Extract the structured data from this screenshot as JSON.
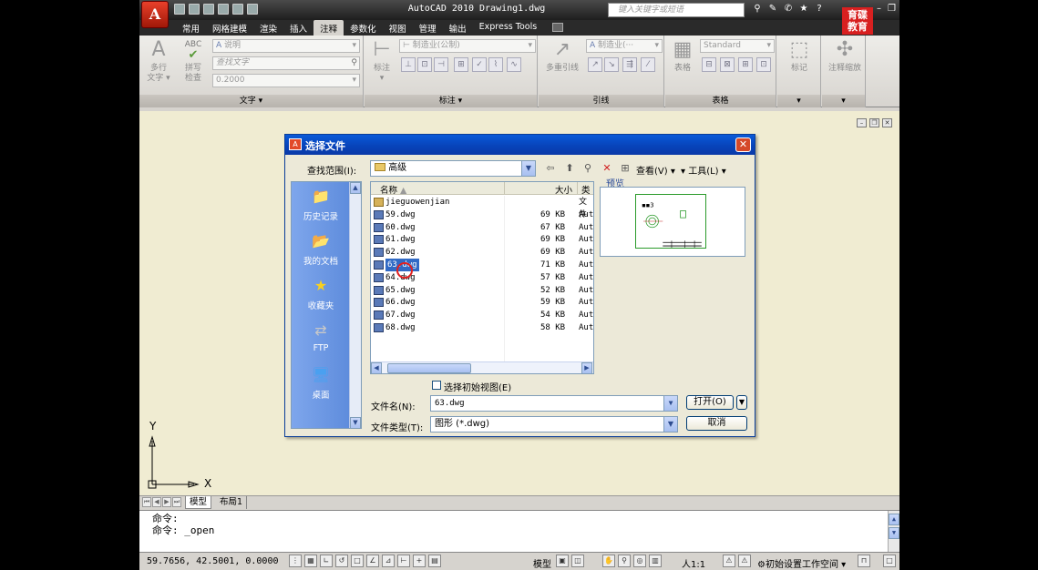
{
  "titlebar": {
    "app_logo": "A",
    "title": "AutoCAD 2010  Drawing1.dwg",
    "search_placeholder": "键入关键字或短语",
    "watermark_line1": "育碟",
    "watermark_line2": "教育"
  },
  "ribbon_tabs": [
    "常用",
    "网格建模",
    "渲染",
    "插入",
    "注释",
    "参数化",
    "视图",
    "管理",
    "输出",
    "Express Tools"
  ],
  "ribbon_active_tab": "注释",
  "ribbon": {
    "text_group": {
      "title": "文字",
      "multiline_text_label_1": "多行",
      "multiline_text_label_2": "文字",
      "spell_label_1": "拼写",
      "spell_label_2": "检查",
      "style_value": "说明",
      "find_placeholder": "查找文字",
      "height_value": "0.2000"
    },
    "dimension_group": {
      "title": "标注",
      "dim_label": "标注",
      "style_value": "制造业(公制)"
    },
    "leader_group": {
      "title": "引线",
      "multileader_label": "多重引线",
      "style_value": "制造业(···"
    },
    "table_group": {
      "title": "表格",
      "table_label": "表格",
      "style_value": "Standard"
    },
    "markup_group": {
      "markup_label": "标记"
    },
    "annoscale_group": {
      "annoscale_label": "注释缩放"
    }
  },
  "drawing": {
    "ucs_x": "X",
    "ucs_y": "Y"
  },
  "layout_tabs": {
    "model": "模型",
    "layout1": "布局1"
  },
  "command_line": {
    "line1": "命令:",
    "line2": "命令: _open"
  },
  "statusbar": {
    "coords": "59.7656,  42.5001, 0.0000",
    "model_label": "模型",
    "anno_scale": "人1:1",
    "workspace": "初始设置工作空间"
  },
  "dialog": {
    "title": "选择文件",
    "look_in_label": "查找范围(I):",
    "look_in_value": "高级",
    "views_label": "查看(V)",
    "tools_label": "工具(L)",
    "places": [
      {
        "label": "历史记录",
        "icon": "history-folder-icon"
      },
      {
        "label": "我的文档",
        "icon": "my-documents-icon"
      },
      {
        "label": "收藏夹",
        "icon": "favorites-star-icon"
      },
      {
        "label": "FTP",
        "icon": "ftp-icon"
      },
      {
        "label": "桌面",
        "icon": "desktop-icon"
      }
    ],
    "columns": {
      "name": "名称",
      "size": "大小",
      "type": "类"
    },
    "files": [
      {
        "name": "jieguowenjian",
        "size": "",
        "type": "文件",
        "kind": "folder"
      },
      {
        "name": "59.dwg",
        "size": "69 KB",
        "type": "Aut",
        "kind": "dwg"
      },
      {
        "name": "60.dwg",
        "size": "67 KB",
        "type": "Aut",
        "kind": "dwg"
      },
      {
        "name": "61.dwg",
        "size": "69 KB",
        "type": "Aut",
        "kind": "dwg"
      },
      {
        "name": "62.dwg",
        "size": "69 KB",
        "type": "Aut",
        "kind": "dwg"
      },
      {
        "name": "63.dwg",
        "size": "71 KB",
        "type": "Aut",
        "kind": "dwg",
        "selected": true
      },
      {
        "name": "64.dwg",
        "size": "57 KB",
        "type": "Aut",
        "kind": "dwg"
      },
      {
        "name": "65.dwg",
        "size": "52 KB",
        "type": "Aut",
        "kind": "dwg"
      },
      {
        "name": "66.dwg",
        "size": "59 KB",
        "type": "Aut",
        "kind": "dwg"
      },
      {
        "name": "67.dwg",
        "size": "54 KB",
        "type": "Aut",
        "kind": "dwg"
      },
      {
        "name": "68.dwg",
        "size": "58 KB",
        "type": "Aut",
        "kind": "dwg"
      }
    ],
    "preview_label": "预览",
    "initial_view_label": "选择初始视图(E)",
    "filename_label": "文件名(N):",
    "filename_value": "63.dwg",
    "filetype_label": "文件类型(T):",
    "filetype_value": "图形 (*.dwg)",
    "open_button": "打开(O)",
    "cancel_button": "取消"
  }
}
